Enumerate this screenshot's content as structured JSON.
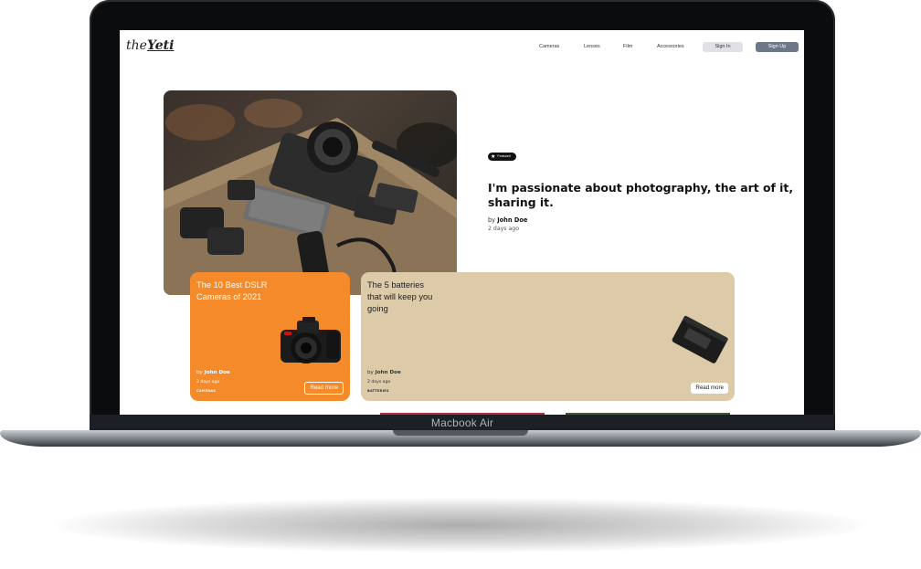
{
  "device": {
    "label": "Macbook Air"
  },
  "site": {
    "logo": {
      "prefix": "the",
      "name": "Yeti"
    },
    "nav": [
      {
        "label": "Cameras"
      },
      {
        "label": "Lenses"
      },
      {
        "label": "Film"
      },
      {
        "label": "Accessories"
      }
    ],
    "auth": {
      "signin": "Sign In",
      "signup": "Sign Up"
    }
  },
  "hero": {
    "badge": "Featured",
    "title": "I'm passionate about photography, the art of it, sharing it.",
    "author_prefix": "by",
    "author": "John Doe",
    "date": "2 days ago"
  },
  "cards": [
    {
      "title": "The 10 Best DSLR Cameras of 2021",
      "author_prefix": "by",
      "author": "John Doe",
      "date": "2 days ago",
      "category": "CAMERAS",
      "cta": "Read more",
      "color": "#f58a2a"
    },
    {
      "title": "The 5 batteries that will keep you going",
      "author_prefix": "by",
      "author": "John Doe",
      "date": "2 days ago",
      "category": "BATTERIES",
      "cta": "Read more",
      "color": "#dccaa8"
    }
  ]
}
